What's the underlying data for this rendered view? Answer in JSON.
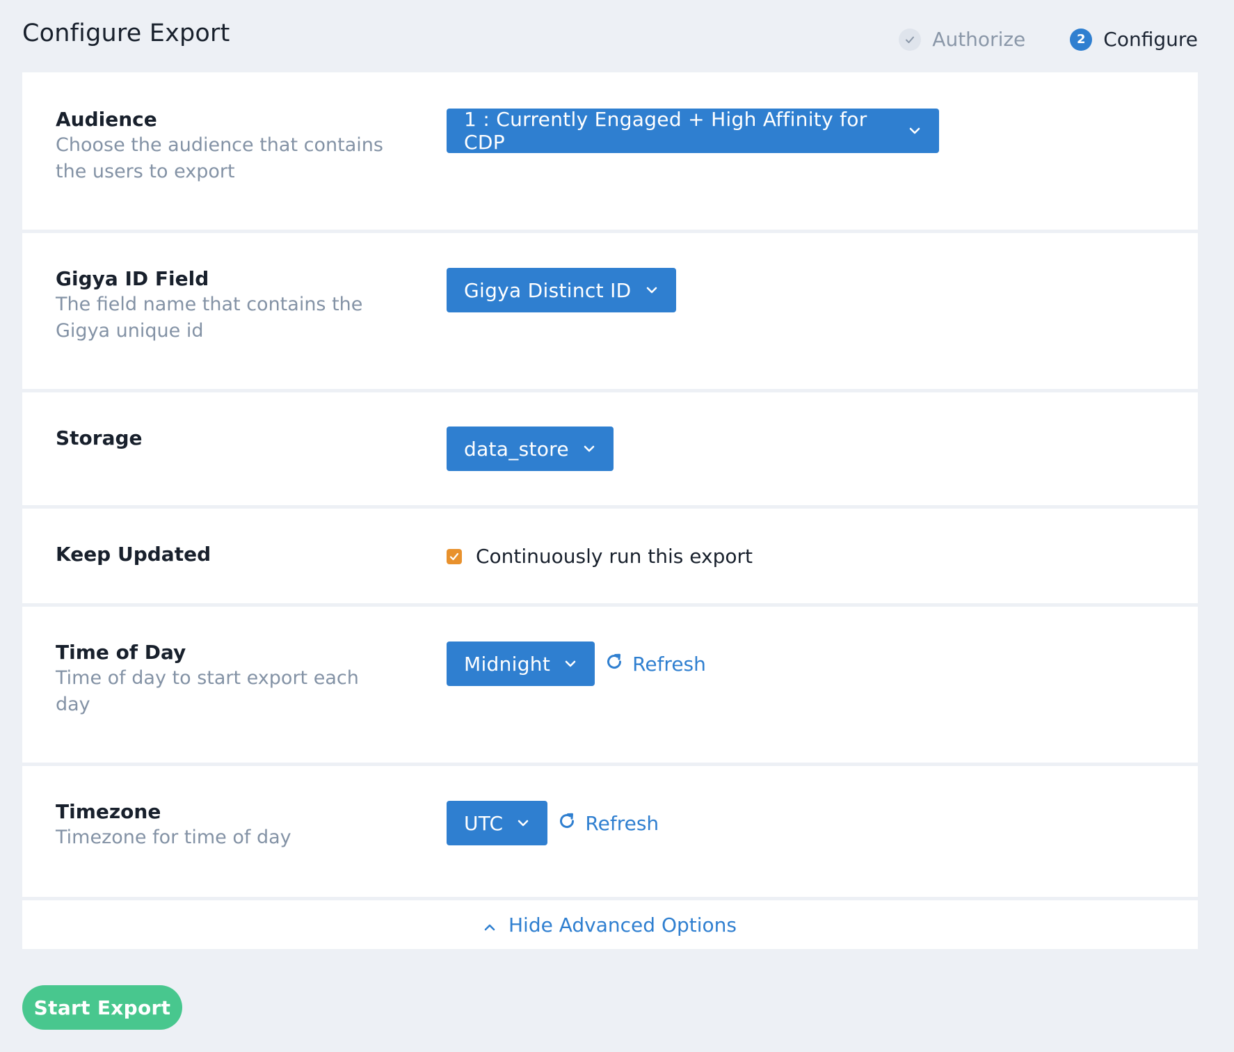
{
  "header": {
    "title": "Configure Export"
  },
  "stepper": {
    "steps": [
      {
        "label": "Authorize",
        "state": "done",
        "icon": "check-icon"
      },
      {
        "label": "Configure",
        "state": "active",
        "number": "2"
      }
    ]
  },
  "form": {
    "audience": {
      "title": "Audience",
      "description": "Choose the audience that contains the users to export",
      "selected": "1 : Currently Engaged + High Affinity for CDP"
    },
    "gigya_id_field": {
      "title": "Gigya ID Field",
      "description": "The field name that contains the Gigya unique id",
      "selected": "Gigya Distinct ID"
    },
    "storage": {
      "title": "Storage",
      "selected": "data_store"
    },
    "keep_updated": {
      "title": "Keep Updated",
      "checkbox_label": "Continuously run this export",
      "checked": true
    },
    "time_of_day": {
      "title": "Time of Day",
      "description": "Time of day to start export each day",
      "selected": "Midnight",
      "refresh_label": "Refresh"
    },
    "timezone": {
      "title": "Timezone",
      "description": "Timezone for time of day",
      "selected": "UTC",
      "refresh_label": "Refresh"
    },
    "advanced_toggle": "Hide Advanced Options"
  },
  "actions": {
    "start_export": "Start Export"
  },
  "colors": {
    "background": "#edf0f5",
    "primary": "#2f7fd0",
    "success": "#48c78e",
    "checkbox": "#e8912d",
    "muted_text": "#8392a5"
  }
}
